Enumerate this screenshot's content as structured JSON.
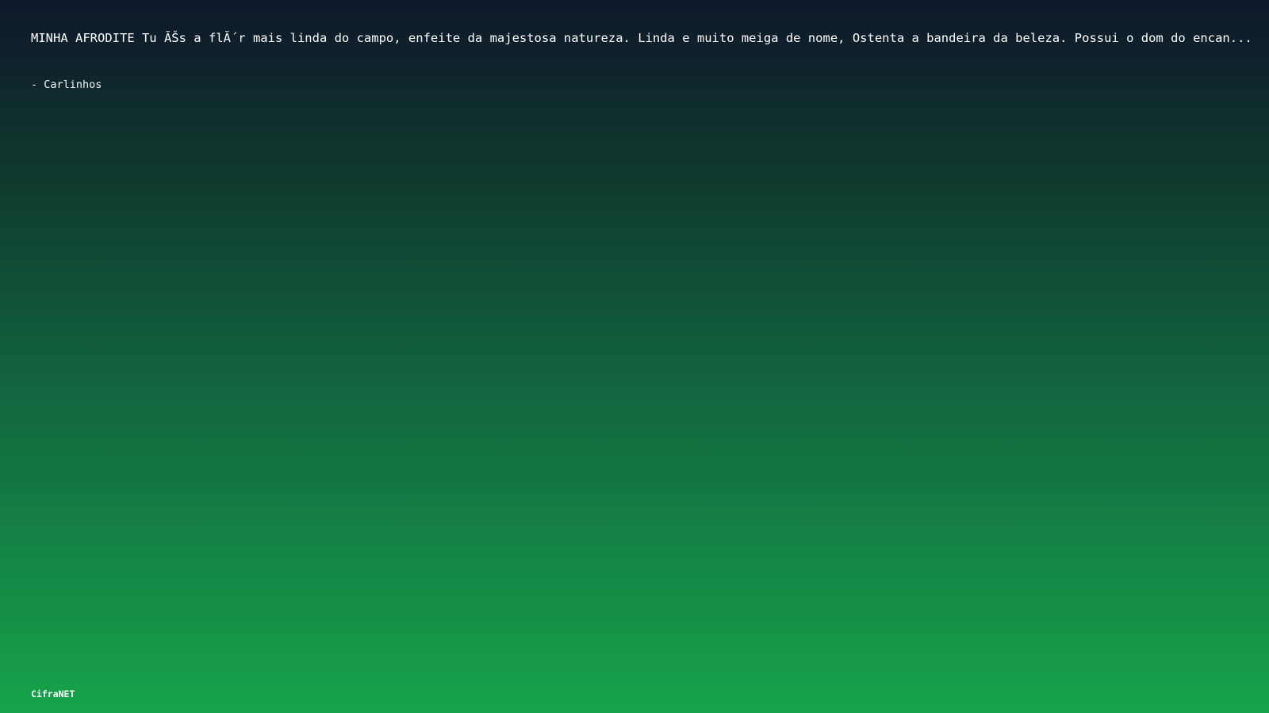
{
  "quote": {
    "text": "MINHA AFRODITE Tu ĂŠs a flĂ´r mais linda do campo, enfeite da majestosa natureza. Linda e muito meiga de nome, Ostenta a bandeira da beleza. Possui o dom do encan..."
  },
  "author": {
    "text": "- Carlinhos"
  },
  "footer": {
    "brand": "CifraNET"
  },
  "colors": {
    "gradient_top": "#0f172a",
    "gradient_bottom": "#16a34a",
    "text": "#ffffff"
  }
}
